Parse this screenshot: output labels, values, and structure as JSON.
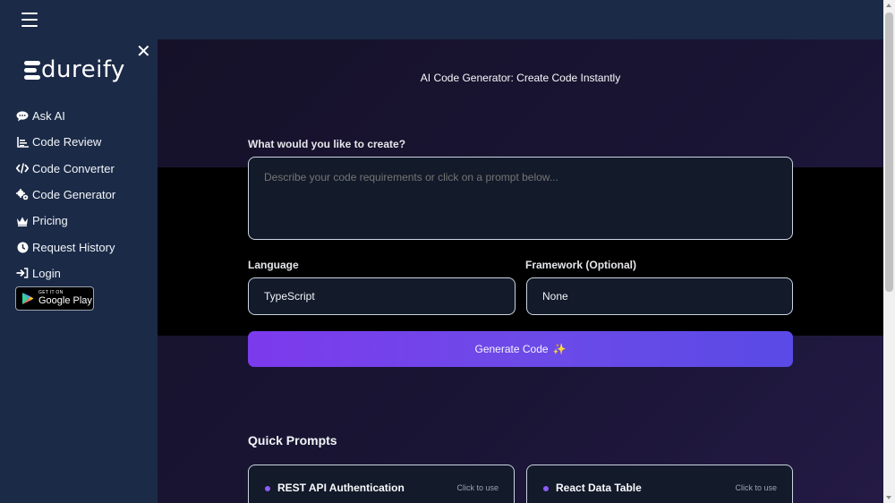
{
  "sidebar": {
    "logo_text": "dureify",
    "close_glyph": "✕",
    "items": [
      {
        "label": "Ask AI",
        "icon": "chat-icon"
      },
      {
        "label": "Code Review",
        "icon": "chart-icon"
      },
      {
        "label": "Code Converter",
        "icon": "code-icon"
      },
      {
        "label": "Code Generator",
        "icon": "gears-icon"
      },
      {
        "label": "Pricing",
        "icon": "crown-icon"
      },
      {
        "label": "Request History",
        "icon": "history-icon"
      },
      {
        "label": "Login",
        "icon": "login-icon"
      }
    ],
    "store_badge": {
      "small": "GET IT ON",
      "big": "Google Play"
    }
  },
  "main": {
    "title": "AI Code Generator: Create Code Instantly",
    "prompt_label": "What would you like to create?",
    "prompt_placeholder": "Describe your code requirements or click on a prompt below...",
    "language_label": "Language",
    "language_value": "TypeScript",
    "framework_label": "Framework (Optional)",
    "framework_value": "None",
    "generate_label": "Generate Code",
    "generate_glyph": "✨",
    "quick_prompts_title": "Quick Prompts",
    "cards": [
      {
        "title": "REST API Authentication",
        "hint": "Click to use",
        "desc": ""
      },
      {
        "title": "React Data Table",
        "hint": "Click to use",
        "desc": ""
      }
    ]
  },
  "colors": {
    "sidebar_bg": "#1b2a47",
    "main_bg": "#161129",
    "accent_purple": "#7c3aed",
    "accent_indigo": "#5a4ae6",
    "input_bg": "#131a2a"
  }
}
